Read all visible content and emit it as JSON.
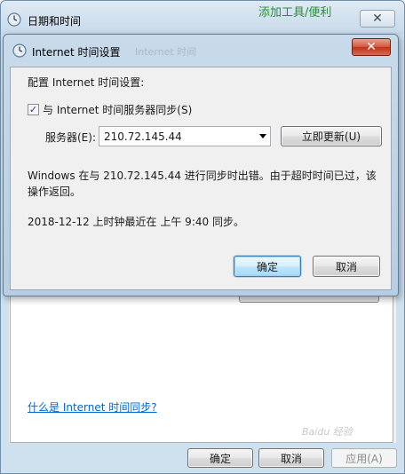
{
  "background_window": {
    "title": "日期和时间",
    "close_glyph": "✕",
    "partial_top_link": "添加工具/便利",
    "help_link": "什么是 Internet 时间同步?",
    "ok_label": "确定",
    "cancel_label": "取消",
    "apply_label": "应用(A)"
  },
  "dialog": {
    "title": "Internet 时间设置",
    "ghost_title": "Internet 时间",
    "close_glyph": "✕",
    "prompt": "配置 Internet 时间设置:",
    "sync_checkbox": {
      "label": "与 Internet 时间服务器同步(S)",
      "checked": true,
      "check_glyph": "✓"
    },
    "server_label": "服务器(E):",
    "server_value": "210.72.145.44",
    "update_now_label": "立即更新(U)",
    "error_message": "Windows 在与 210.72.145.44 进行同步时出错。由于超时时间已过，该操作返回。",
    "last_sync": "2018-12-12 上时钟最近在 上午 9:40 同步。",
    "ok_label": "确定",
    "cancel_label": "取消"
  },
  "watermark": "Baidu 经验",
  "icons": {
    "window_icon": "clock-globe-icon",
    "dropdown": "chevron-down-icon"
  },
  "colors": {
    "link": "#0066cc",
    "close_button": "#c0321a",
    "default_button_border": "#3c7fb1"
  }
}
